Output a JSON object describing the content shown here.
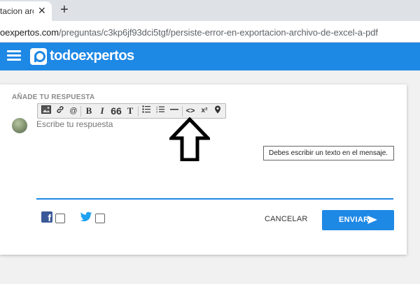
{
  "browser": {
    "tab_title": "tacion archi",
    "tab_close": "✕",
    "new_tab": "+",
    "url_host": "oexpertos.com",
    "url_path": "/preguntas/c3kp6jf93dci5tgf/persiste-error-en-exportacion-archivo-de-excel-a-pdf"
  },
  "header": {
    "brand": "todoexpertos",
    "brand_color": "#1e88e5"
  },
  "reply": {
    "section_title": "AÑADE TU RESPUESTA",
    "placeholder": "Escribe tu respuesta",
    "tooltip": "Debes escribir un texto en el mensaje.",
    "toolbar": {
      "bold": "B",
      "italic": "I",
      "quote": "66",
      "text": "T",
      "code": "<>",
      "superscript": "x²"
    },
    "cancel_label": "CANCELAR",
    "send_label": "ENVIAR",
    "facebook_glyph": "f"
  }
}
